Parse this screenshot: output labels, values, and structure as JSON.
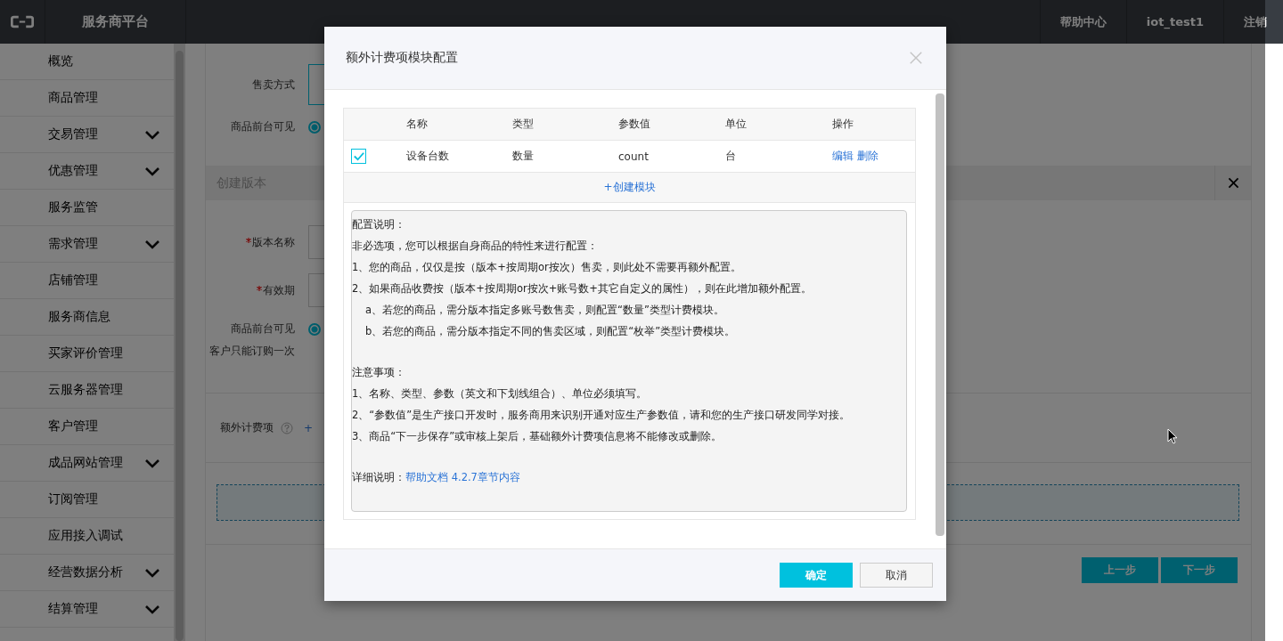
{
  "topbar": {
    "title": "服务商平台",
    "links": [
      "帮助中心",
      "iot_test1",
      "注销"
    ]
  },
  "sidebar": {
    "items": [
      {
        "label": "概览",
        "expandable": false
      },
      {
        "label": "商品管理",
        "expandable": false
      },
      {
        "label": "交易管理",
        "expandable": true
      },
      {
        "label": "优惠管理",
        "expandable": true
      },
      {
        "label": "服务监管",
        "expandable": false
      },
      {
        "label": "需求管理",
        "expandable": true
      },
      {
        "label": "店铺管理",
        "expandable": false
      },
      {
        "label": "服务商信息",
        "expandable": false
      },
      {
        "label": "买家评价管理",
        "expandable": false
      },
      {
        "label": "云服务器管理",
        "expandable": false
      },
      {
        "label": "客户管理",
        "expandable": false
      },
      {
        "label": "成品网站管理",
        "expandable": true
      },
      {
        "label": "订阅管理",
        "expandable": false
      },
      {
        "label": "应用接入调试",
        "expandable": false
      },
      {
        "label": "经营数据分析",
        "expandable": true
      },
      {
        "label": "结算管理",
        "expandable": true
      }
    ]
  },
  "form": {
    "sale_label": "售卖方式",
    "visible_label": "商品前台可见",
    "visible_selected": true,
    "version_section": {
      "title": "创建版本",
      "fields": [
        {
          "label": "版本名称",
          "required": true
        },
        {
          "label": "有效期",
          "required": true
        }
      ],
      "visible_label": "商品前台可见",
      "visible_selected": true,
      "once_label": "客户只能订购一次"
    },
    "extra_label": "额外计费项",
    "extra_link": "+",
    "buttons": [
      "上一步",
      "下一步"
    ]
  },
  "dialog": {
    "title": "额外计费项模块配置",
    "table": {
      "columns": [
        "名称",
        "类型",
        "参数值",
        "单位",
        "操作"
      ],
      "rows": [
        {
          "checked": true,
          "cells": [
            "设备台数",
            "数量",
            "count",
            "台"
          ],
          "actions": [
            "编辑",
            "删除"
          ]
        }
      ],
      "create_link": "+创建模块"
    },
    "notes": {
      "sections": [
        {
          "heading": "配置说明：",
          "lines": [
            {
              "text": "非必选项，您可以根据自身商品的特性来进行配置：",
              "indent": false
            },
            {
              "text": "1、您的商品，仅仅是按（版本+按周期or按次）售卖，则此处不需要再额外配置。",
              "indent": false
            },
            {
              "text": "2、如果商品收费按（版本+按周期or按次+账号数+其它自定义的属性），则在此增加额外配置。",
              "indent": false
            },
            {
              "text": "a、若您的商品，需分版本指定多账号数售卖，则配置“数量”类型计费模块。",
              "indent": true
            },
            {
              "text": "b、若您的商品，需分版本指定不同的售卖区域，则配置“枚举”类型计费模块。",
              "indent": true
            }
          ]
        },
        {
          "heading": "注意事项：",
          "lines": [
            {
              "text": "1、名称、类型、参数（英文和下划线组合）、单位必须填写。",
              "indent": false
            },
            {
              "text": "2、“参数值”是生产接口开发时，服务商用来识别开通对应生产参数值，请和您的生产接口研发同学对接。",
              "indent": false
            },
            {
              "text": "3、商品“下一步保存”或审核上架后，基础额外计费项信息将不能修改或删除。",
              "indent": false
            }
          ]
        }
      ],
      "detail_label": "详细说明：",
      "detail_link": "帮助文档 4.2.7章节内容"
    },
    "buttons": [
      {
        "label": "确定",
        "primary": true
      },
      {
        "label": "取消",
        "primary": false
      }
    ]
  }
}
